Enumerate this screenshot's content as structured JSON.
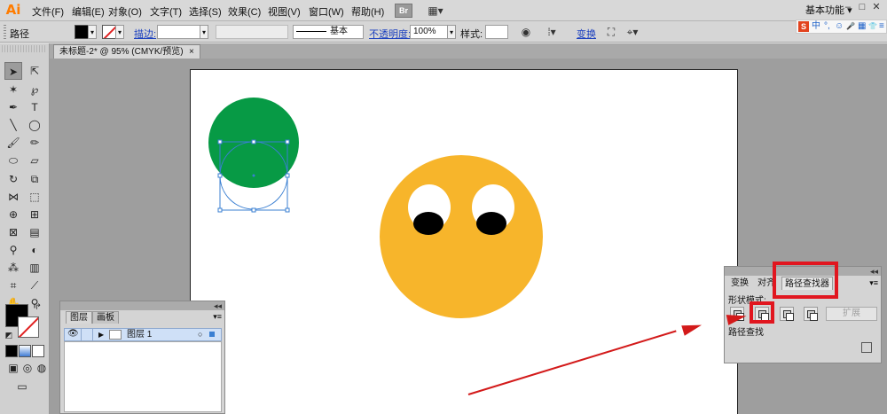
{
  "app": {
    "logo": "Ai"
  },
  "menu": {
    "items": [
      "文件(F)",
      "编辑(E)",
      "对象(O)",
      "文字(T)",
      "选择(S)",
      "效果(C)",
      "视图(V)",
      "窗口(W)",
      "帮助(H)"
    ],
    "bridge_label": "Br",
    "workspace": "基本功能",
    "workspace_arrow": "▾",
    "minimize": "–",
    "restore": "□",
    "close": "✕"
  },
  "ime": {
    "logo": "S",
    "lang": "中",
    "items": [
      "°,",
      "☺",
      "🎤",
      "▦",
      "👕",
      "≡"
    ]
  },
  "control": {
    "selection_label": "路径",
    "stroke_label": "描边:",
    "stroke_weight": "",
    "profile": "",
    "brush_label": "基本",
    "opacity_label": "不透明度:",
    "opacity_value": "100%",
    "style_label": "样式:",
    "transform_label": "变换"
  },
  "document": {
    "tab_title": "未标题-2* @ 95% (CMYK/预览)",
    "close": "×"
  },
  "colors": {
    "green": "#079a45",
    "orange": "#f7b52b",
    "black": "#000000",
    "white": "#ffffff",
    "selection": "#3a7fd2",
    "annotation": "#e1161f"
  },
  "layers_panel": {
    "collapse": "◂◂",
    "close": "✕",
    "tabs": [
      "图层",
      "画板"
    ],
    "menu": "▾≡",
    "layer_name": "图层 1"
  },
  "pathfinder_panel": {
    "collapse": "◂◂",
    "close": "✕",
    "tabs": [
      "变换",
      "对齐",
      "路径查找器"
    ],
    "menu": "▾≡",
    "shape_modes_label": "形状模式:",
    "pathfinders_label": "路径查找",
    "expand_label": "扩展"
  }
}
